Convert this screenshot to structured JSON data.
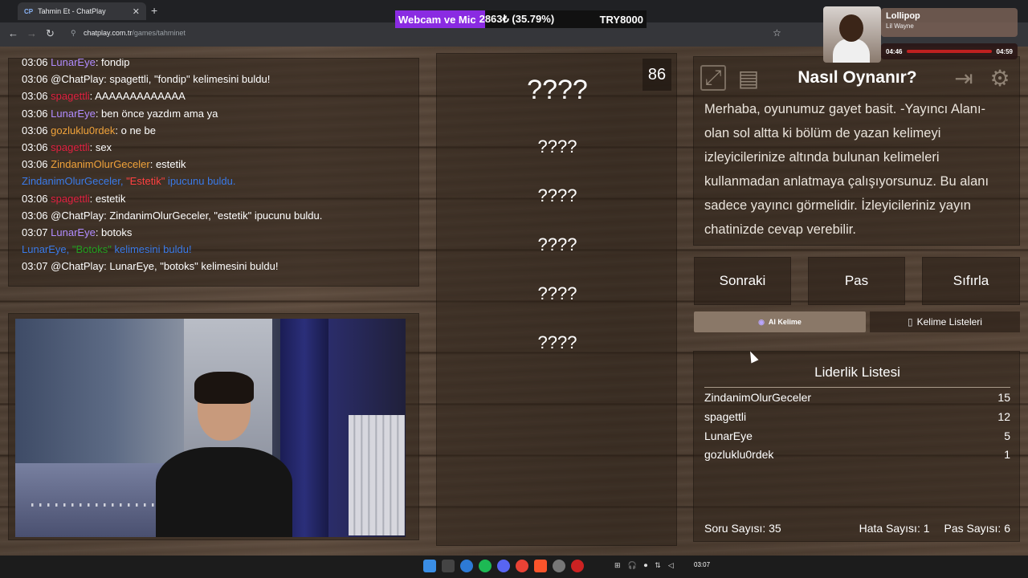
{
  "browser": {
    "tab_title": "Tahmin Et - ChatPlay",
    "tab_favicon": "CP",
    "url_domain": "chatplay.com.tr",
    "url_path": "/games/tahminet"
  },
  "stream_overlay": {
    "goal_title": "Webcam ve Mic",
    "goal_amount": "2863₺ (35.79%)",
    "goal_progress": 0.3579,
    "goal_target": "TRY8000",
    "song_title": "Lollipop",
    "song_artist": "Lil Wayne",
    "song_elapsed": "04:46",
    "song_total": "04:59"
  },
  "chat": {
    "lines": [
      {
        "time": "03:06",
        "user": "LunarEye",
        "user_class": "u-lunar",
        "text": ": fondip"
      },
      {
        "time": "03:06",
        "user": "@ChatPlay",
        "user_class": "",
        "text": ": spagettli, \"fondip\" kelimesini buldu!"
      },
      {
        "time": "03:06",
        "user": "spagettli",
        "user_class": "u-spag",
        "text": ": AAAAAAAAAAAAA"
      },
      {
        "time": "03:06",
        "user": "LunarEye",
        "user_class": "u-lunar",
        "text": ": ben önce yazdım ama ya"
      },
      {
        "time": "03:06",
        "user": "gozluklu0rdek",
        "user_class": "u-gozl",
        "text": ": o ne be"
      },
      {
        "time": "03:06",
        "user": "spagettli",
        "user_class": "u-spag",
        "text": ": sex"
      },
      {
        "time": "03:06",
        "user": "ZindanimOlurGeceler",
        "user_class": "u-zind",
        "text": ": estetik"
      },
      {
        "time": "",
        "user": "ZindanimOlurGeceler",
        "user_class": "u-blue",
        "text": "",
        "special": "estetik"
      },
      {
        "time": "03:06",
        "user": "spagettli",
        "user_class": "u-spag",
        "text": ": estetik"
      },
      {
        "time": "03:06",
        "user": "@ChatPlay",
        "user_class": "",
        "text": ": ZindanimOlurGeceler, \"estetik\" ipucunu buldu."
      },
      {
        "time": "03:07",
        "user": "LunarEye",
        "user_class": "u-lunar",
        "text": ": botoks"
      },
      {
        "time": "",
        "user": "LunarEye",
        "user_class": "u-blue",
        "text": "",
        "special": "botoks"
      },
      {
        "time": "03:07",
        "user": "@ChatPlay",
        "user_class": "",
        "text": ": LunarEye, \"botoks\" kelimesini buldu!"
      }
    ],
    "notice_estetik": {
      "pre": "ZindanimOlurGeceler, ",
      "word": "\"Estetik\"",
      "post": " ipucunu buldu."
    },
    "notice_botoks": {
      "pre": "LunarEye, ",
      "word": "\"Botoks\"",
      "post": " kelimesini buldu!"
    }
  },
  "game": {
    "counter": "86",
    "hidden_main": "????",
    "hidden_words": [
      "????",
      "????",
      "????",
      "????",
      "????"
    ]
  },
  "help": {
    "title": "Nasıl Oynanır?",
    "body": "Merhaba, oyunumuz gayet basit. -Yayıncı Alanı- olan sol altta ki bölüm de yazan kelimeyi izleyicilerinize altında bulunan kelimeleri kullanmadan anlatmaya çalışıyorsunuz. Bu alanı sadece yayıncı görmelidir. İzleyicileriniz yayın chatinizde cevap verebilir."
  },
  "controls": {
    "next": "Sonraki",
    "pass": "Pas",
    "reset": "Sıfırla",
    "ai_word": "AI Kelime",
    "word_lists": "Kelime Listeleri"
  },
  "leaderboard": {
    "title": "Liderlik Listesi",
    "rows": [
      {
        "name": "ZindanimOlurGeceler",
        "score": "15"
      },
      {
        "name": "spagettli",
        "score": "12"
      },
      {
        "name": "LunarEye",
        "score": "5"
      },
      {
        "name": "gozluklu0rdek",
        "score": "1"
      }
    ],
    "question_count": "Soru Sayısı: 35",
    "error_count": "Hata Sayısı: 1",
    "pass_count": "Pas Sayısı: 6"
  },
  "taskbar": {
    "clock": "03:07"
  }
}
